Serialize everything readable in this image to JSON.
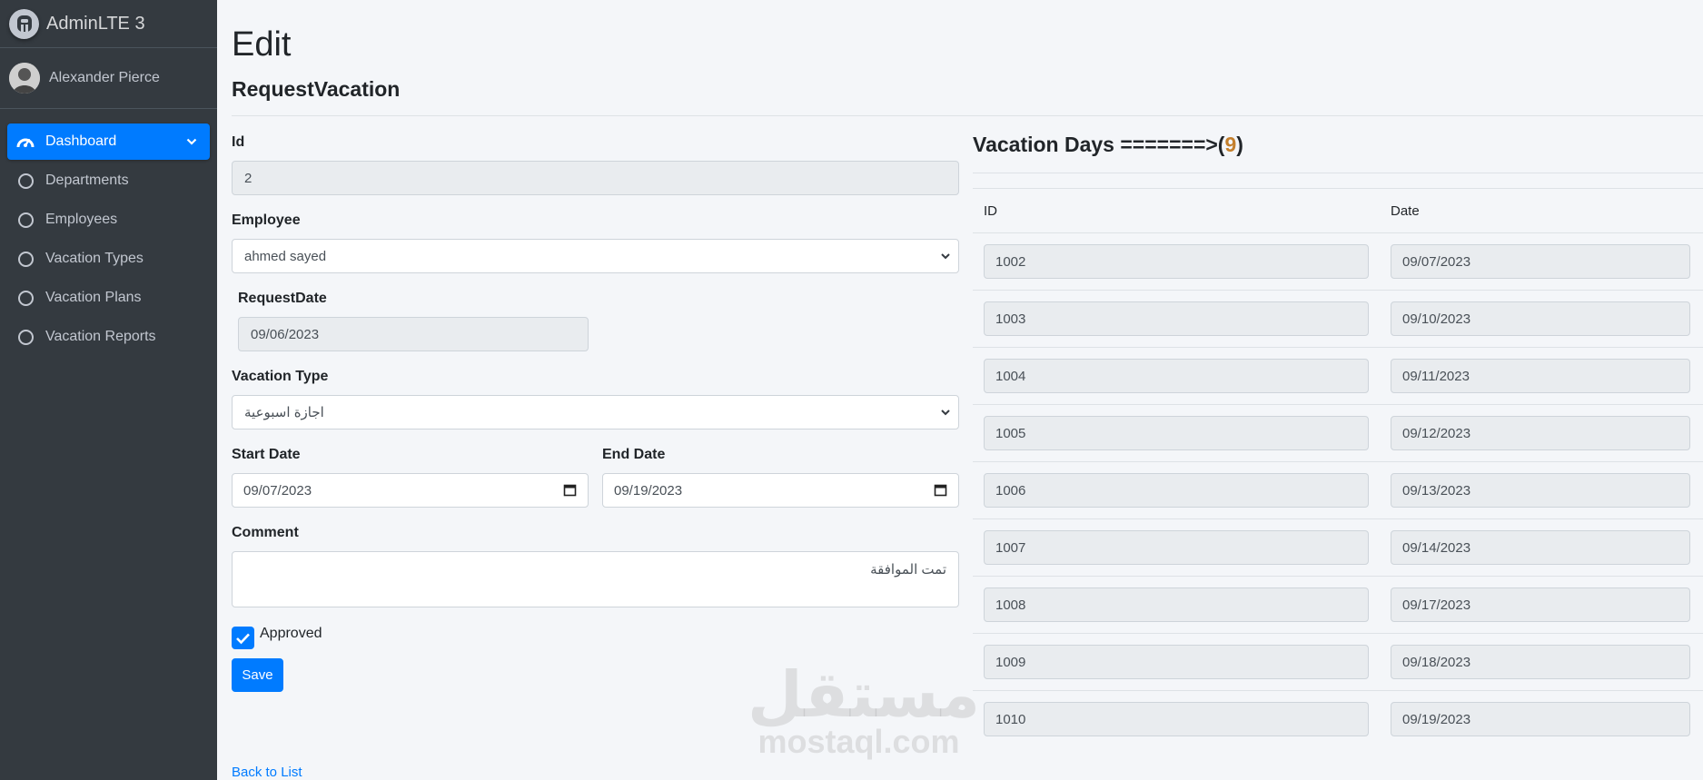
{
  "brand": {
    "name": "AdminLTE 3"
  },
  "user": {
    "name": "Alexander Pierce"
  },
  "sidebar": {
    "items": [
      {
        "label": "Dashboard",
        "icon": "tachometer-icon",
        "active": true
      },
      {
        "label": "Departments",
        "icon": "circle-icon"
      },
      {
        "label": "Employees",
        "icon": "circle-icon"
      },
      {
        "label": "Vacation Types",
        "icon": "circle-icon"
      },
      {
        "label": "Vacation Plans",
        "icon": "circle-icon"
      },
      {
        "label": "Vacation Reports",
        "icon": "circle-icon"
      }
    ]
  },
  "page": {
    "title": "Edit",
    "subtitle": "RequestVacation"
  },
  "form": {
    "id_label": "Id",
    "id_value": "2",
    "employee_label": "Employee",
    "employee_value": "ahmed sayed",
    "request_date_label": "RequestDate",
    "request_date_value": "09/06/2023",
    "vacation_type_label": "Vacation Type",
    "vacation_type_value": "اجازة اسبوعية",
    "start_date_label": "Start Date",
    "start_date_value": "09/07/2023",
    "end_date_label": "End Date",
    "end_date_value": "09/19/2023",
    "comment_label": "Comment",
    "comment_value": "تمت الموافقة",
    "approved_label": "Approved",
    "approved": true,
    "save_label": "Save",
    "back_label": "Back to List"
  },
  "vacation_days": {
    "title_prefix": "Vacation Days =======>(",
    "count": "9",
    "title_suffix": ")",
    "columns": [
      "ID",
      "Date"
    ],
    "rows": [
      {
        "id": "1002",
        "date": "09/07/2023"
      },
      {
        "id": "1003",
        "date": "09/10/2023"
      },
      {
        "id": "1004",
        "date": "09/11/2023"
      },
      {
        "id": "1005",
        "date": "09/12/2023"
      },
      {
        "id": "1006",
        "date": "09/13/2023"
      },
      {
        "id": "1007",
        "date": "09/14/2023"
      },
      {
        "id": "1008",
        "date": "09/17/2023"
      },
      {
        "id": "1009",
        "date": "09/18/2023"
      },
      {
        "id": "1010",
        "date": "09/19/2023"
      }
    ]
  },
  "watermark": {
    "arabic": "مستقل",
    "latin": "mostaql.com"
  },
  "colors": {
    "primary": "#007bff",
    "sidebar": "#343a40",
    "count_accent": "#c47f2c"
  }
}
